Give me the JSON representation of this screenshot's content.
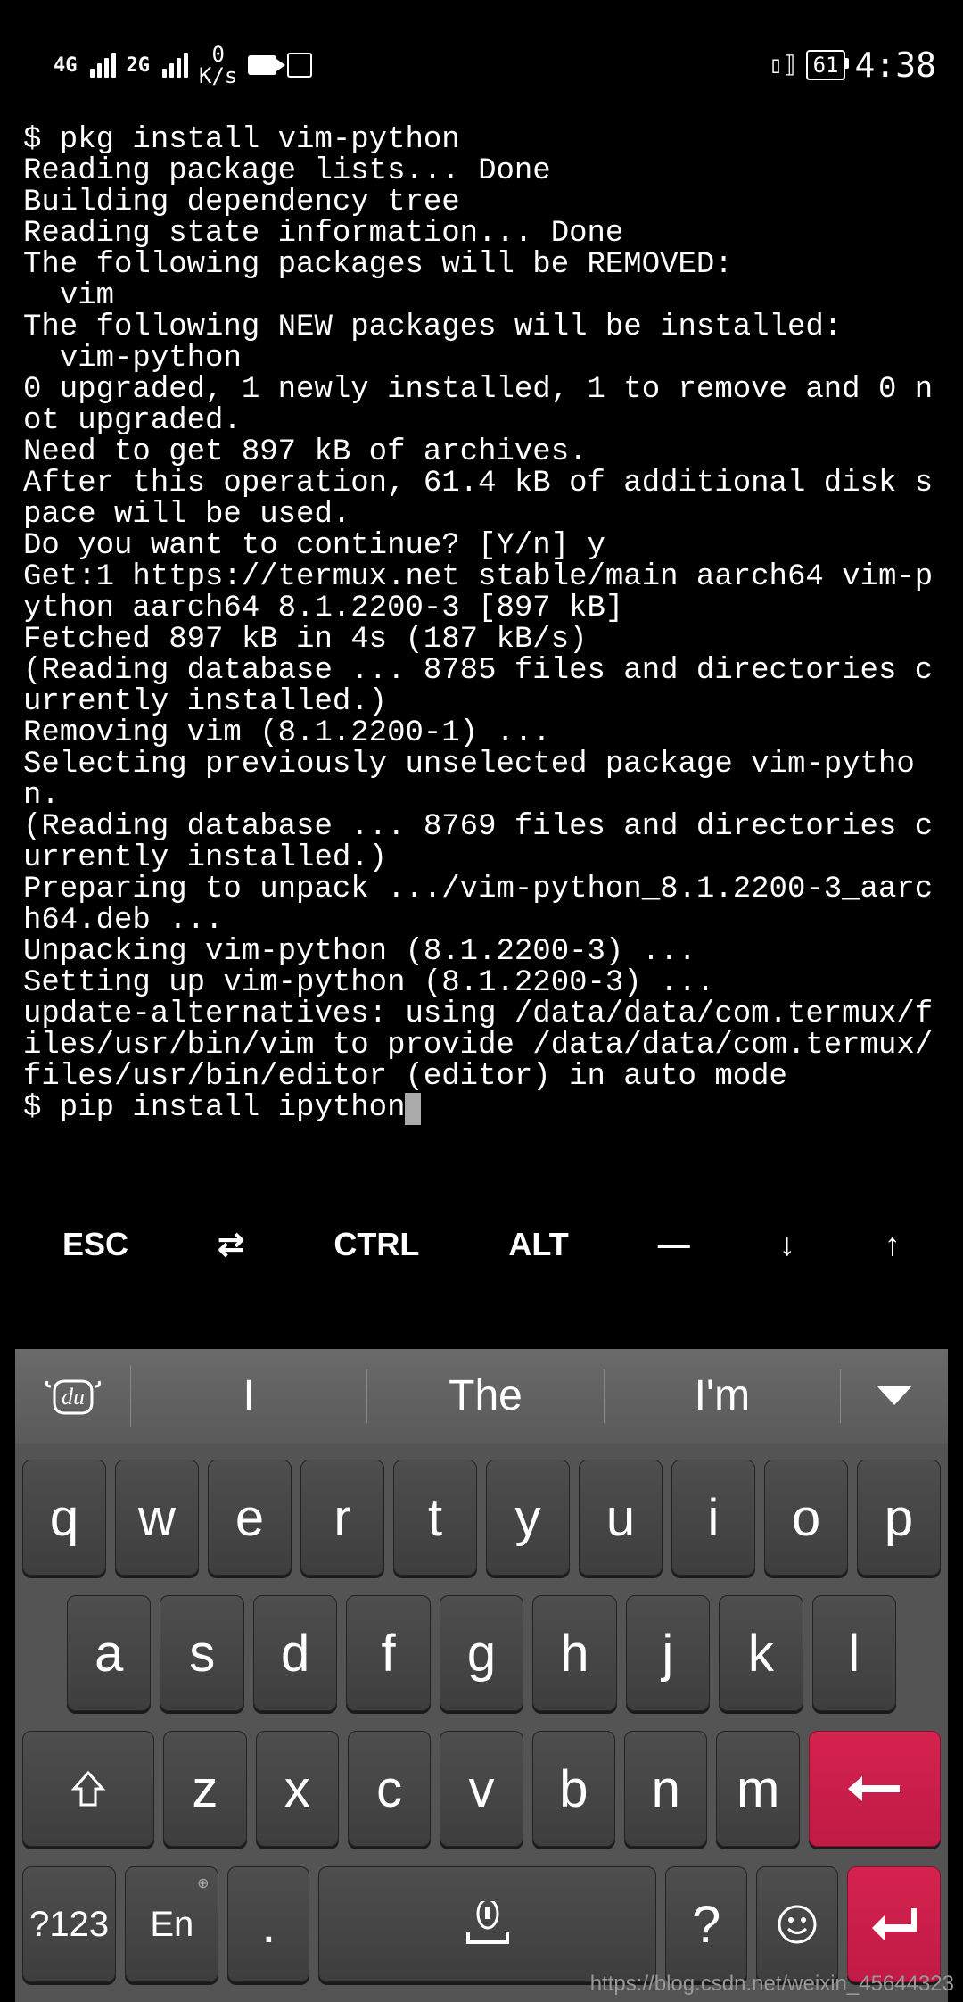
{
  "status": {
    "net1": "4G",
    "net2": "2G",
    "speed_top": "0",
    "speed_unit": "K/s",
    "battery": "61",
    "time": "4:38"
  },
  "terminal": {
    "prompt1": "$ pkg install vim-python",
    "output": "Reading package lists... Done\nBuilding dependency tree\nReading state information... Done\nThe following packages will be REMOVED:\n  vim\nThe following NEW packages will be installed:\n  vim-python\n0 upgraded, 1 newly installed, 1 to remove and 0 not upgraded.\nNeed to get 897 kB of archives.\nAfter this operation, 61.4 kB of additional disk space will be used.\nDo you want to continue? [Y/n] y\nGet:1 https://termux.net stable/main aarch64 vim-python aarch64 8.1.2200-3 [897 kB]\nFetched 897 kB in 4s (187 kB/s)\n(Reading database ... 8785 files and directories currently installed.)\nRemoving vim (8.1.2200-1) ...\nSelecting previously unselected package vim-python.\n(Reading database ... 8769 files and directories currently installed.)\nPreparing to unpack .../vim-python_8.1.2200-3_aarch64.deb ...\nUnpacking vim-python (8.1.2200-3) ...\nSetting up vim-python (8.1.2200-3) ...\nupdate-alternatives: using /data/data/com.termux/files/usr/bin/vim to provide /data/data/com.termux/files/usr/bin/editor (editor) in auto mode",
    "prompt2": "$ pip install ipython"
  },
  "toolbar": {
    "esc": "ESC",
    "tab": "⇄",
    "ctrl": "CTRL",
    "alt": "ALT",
    "dash": "—",
    "down": "↓",
    "up": "↑"
  },
  "suggestions": [
    "I",
    "The",
    "I'm"
  ],
  "rows": [
    [
      "q",
      "w",
      "e",
      "r",
      "t",
      "y",
      "u",
      "i",
      "o",
      "p"
    ],
    [
      "a",
      "s",
      "d",
      "f",
      "g",
      "h",
      "j",
      "k",
      "l"
    ],
    [
      "z",
      "x",
      "c",
      "v",
      "b",
      "n",
      "m"
    ]
  ],
  "bottom": {
    "sym": "?123",
    "lang": "En",
    "dot": ".",
    "q": "?"
  },
  "watermark": "https://blog.csdn.net/weixin_45644323"
}
